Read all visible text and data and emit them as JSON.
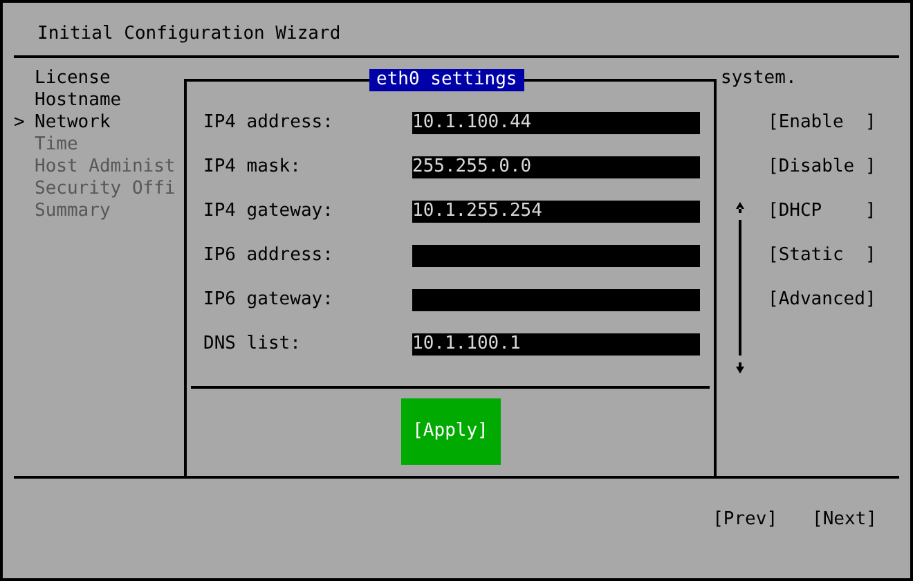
{
  "window": {
    "title": "Initial Configuration Wizard"
  },
  "sidebar": {
    "selected_marker": ">",
    "items": [
      {
        "label": "License",
        "selected": false,
        "disabled": false
      },
      {
        "label": "Hostname",
        "selected": false,
        "disabled": false
      },
      {
        "label": "Network",
        "selected": true,
        "disabled": false
      },
      {
        "label": "Time",
        "selected": false,
        "disabled": true
      },
      {
        "label": "Host Administ",
        "selected": false,
        "disabled": true
      },
      {
        "label": "Security Offi",
        "selected": false,
        "disabled": true
      },
      {
        "label": "Summary",
        "selected": false,
        "disabled": true
      }
    ]
  },
  "main": {
    "text": "system.",
    "buttons": [
      "[Enable  ]",
      "[Disable ]",
      "[DHCP    ]",
      "[Static  ]",
      "[Advanced]"
    ]
  },
  "dialog": {
    "title": "eth0 settings",
    "fields": [
      {
        "label": "IP4 address:",
        "value": "10.1.100.44"
      },
      {
        "label": "IP4 mask:",
        "value": "255.255.0.0"
      },
      {
        "label": "IP4 gateway:",
        "value": "10.1.255.254"
      },
      {
        "label": "IP6 address:"
      },
      {
        "label": "IP6 gateway:"
      },
      {
        "label": "DNS list:",
        "value": "10.1.100.1"
      }
    ],
    "apply_button": "[Apply]"
  },
  "footer": {
    "buttons": [
      "[Prev]",
      "[Next]"
    ]
  }
}
